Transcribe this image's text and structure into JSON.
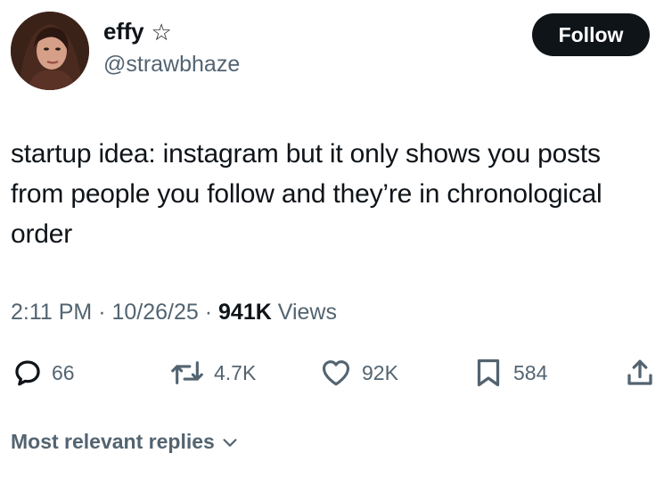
{
  "author": {
    "display_name": "effy",
    "badge_icon": "star-icon",
    "handle": "@strawbhaze",
    "avatar_icon": "avatar"
  },
  "follow_button": {
    "label": "Follow"
  },
  "tweet": {
    "text": "startup idea: instagram but it only shows you posts from people you follow and they’re in chronological order"
  },
  "meta": {
    "time": "2:11 PM",
    "sep1": " · ",
    "date": "10/26/25",
    "sep2": " · ",
    "views_count": "941K",
    "views_label": " Views"
  },
  "actions": {
    "reply": {
      "icon": "reply-icon",
      "count": "66"
    },
    "repost": {
      "icon": "repost-icon",
      "count": "4.7K"
    },
    "like": {
      "icon": "heart-icon",
      "count": "92K"
    },
    "bookmark": {
      "icon": "bookmark-icon",
      "count": "584"
    },
    "share": {
      "icon": "share-icon"
    }
  },
  "replies_sort": {
    "label": "Most relevant replies",
    "icon": "chevron-down-icon"
  },
  "colors": {
    "text_primary": "#0f1419",
    "text_secondary": "#536471",
    "button_bg": "#0f1419",
    "background": "#ffffff"
  }
}
